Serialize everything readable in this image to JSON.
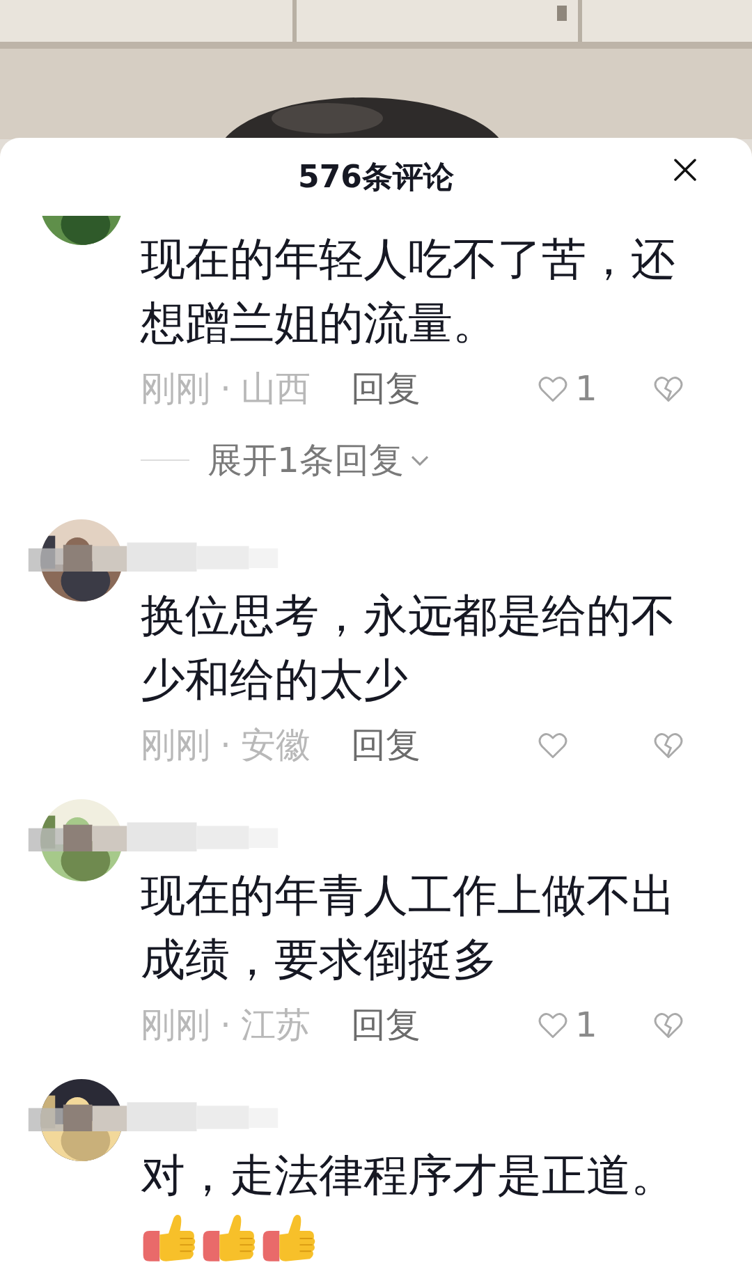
{
  "header": {
    "title": "576条评论"
  },
  "comments": [
    {
      "name_blurred": false,
      "text": "现在的年轻人吃不了苦，还想蹭兰姐的流量。",
      "time": "刚刚",
      "separator": "·",
      "region": "山西",
      "reply": "回复",
      "likes": "1",
      "replies_toggle": "展开1条回复"
    },
    {
      "name_blurred": true,
      "text": "换位思考，永远都是给的不少和给的太少",
      "time": "刚刚",
      "separator": "·",
      "region": "安徽",
      "reply": "回复"
    },
    {
      "name_blurred": true,
      "text": "现在的年青人工作上做不出成绩，要求倒挺多",
      "time": "刚刚",
      "separator": "·",
      "region": "江苏",
      "reply": "回复",
      "likes": "1"
    },
    {
      "name_blurred": true,
      "text": "对，走法律程序才是正道。",
      "reactions": [
        {
          "kind": "thumbs-up"
        },
        {
          "kind": "thumbs-up"
        },
        {
          "kind": "thumbs-up"
        }
      ]
    }
  ]
}
